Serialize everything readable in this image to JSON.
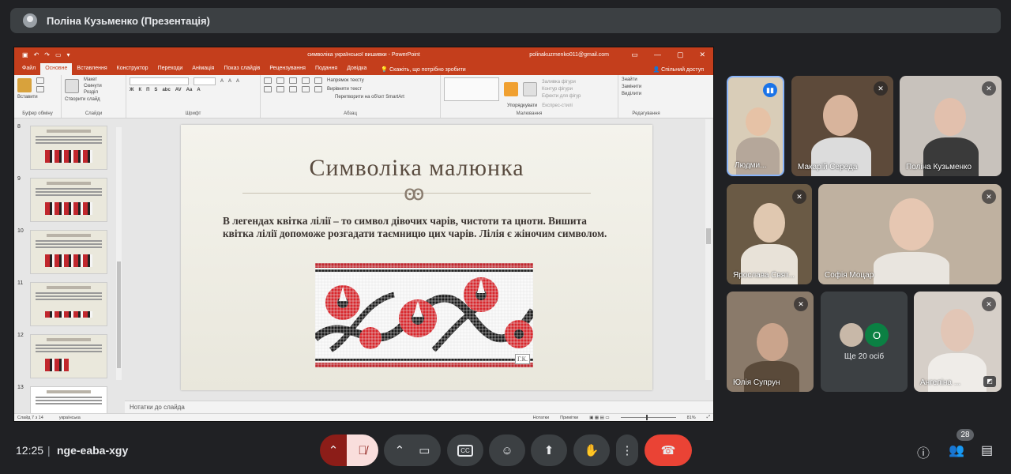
{
  "meeting": {
    "presenter_title": "Поліна Кузьменко (Презентація)",
    "time": "12:25",
    "code": "nge-eaba-xgy",
    "participants_count": "28"
  },
  "powerpoint": {
    "doc_title": "символіка української вишивки - PowerPoint",
    "account": "polinakuzmenko011@gmail.com",
    "tabs": [
      "Файл",
      "Основне",
      "Вставлення",
      "Конструктор",
      "Переходи",
      "Анімація",
      "Показ слайдів",
      "Рецензування",
      "Подання",
      "Довідка"
    ],
    "active_tab": "Основне",
    "tell_me": "Скажіть, що потрібно зробити",
    "share": "Спільний доступ",
    "ribbon": {
      "paste": "Вставити",
      "clipboard": "Буфер обміну",
      "new_slide": "Створити слайд",
      "layout": "Макет",
      "reset": "Скинути",
      "section": "Розділ",
      "slides": "Слайди",
      "font": "Шрифт",
      "text_direction": "Напрямок тексту",
      "align_text": "Вирівняти текст",
      "smartart": "Перетворити на об'єкт SmartArt",
      "paragraph": "Абзац",
      "arrange": "Упорядкувати",
      "quick_styles": "Експрес-стилі",
      "shape_fill": "Заливка фігури",
      "shape_outline": "Контур фігури",
      "shape_effects": "Ефекти для фігур",
      "drawing": "Малювання",
      "find": "Знайти",
      "replace": "Замінити",
      "select": "Виділити",
      "editing": "Редагування"
    },
    "thumbnails": [
      {
        "num": "8",
        "title": "Символіка малюнка"
      },
      {
        "num": "9",
        "title": "Символіка малюнка"
      },
      {
        "num": "10",
        "title": "Символіка малюнка"
      },
      {
        "num": "11",
        "title": "Символіка малюнка"
      },
      {
        "num": "12",
        "title": "Символіка малюнка"
      },
      {
        "num": "13",
        "title": "Символіка малюнка"
      }
    ],
    "slide": {
      "title": "Символіка малюнка",
      "ornament": "ꙭ",
      "body": "В легендах квітка лілії – то символ дівочих чарів, чистоти та цноти. Вишита квітка лілії допоможе розгадати таємницю цих чарів. Лілія є жіночим символом.",
      "signature": "Г.К."
    },
    "notes_placeholder": "Нотатки до слайда",
    "status": {
      "slide_count": "Слайд 7 з 14",
      "language": "українська",
      "notes": "Нотатки",
      "comments": "Примітки",
      "zoom": "81%"
    }
  },
  "participants": [
    {
      "name": "Людми...",
      "speaking": true
    },
    {
      "name": "Макарій Середа",
      "muted": true
    },
    {
      "name": "Поліна Кузьменко",
      "muted": true
    },
    {
      "name": "Ярослава Свят...",
      "muted": true
    },
    {
      "name": "Софія Моцар",
      "muted": true
    },
    {
      "name": "Юлія Супрун",
      "muted": true
    },
    {
      "name": "Ангеліна ...",
      "muted": true
    }
  ],
  "more_people": {
    "label": "Ще 20 осіб",
    "initial": "О"
  },
  "colors": {
    "accent_red": "#ea4335",
    "ppt_red": "#c43e1c",
    "bg": "#202124",
    "tile": "#3c4043"
  }
}
